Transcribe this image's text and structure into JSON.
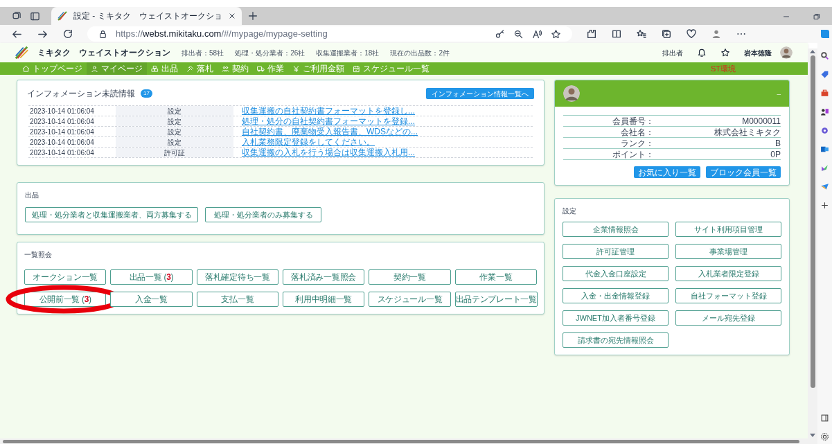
{
  "browser": {
    "tab_title": "設定 - ミキタク　ウェイストオークショ",
    "url_host": "webst.mikitaku.com",
    "url_scheme": "https://",
    "url_path": "/#/mypage/mypage-setting"
  },
  "site": {
    "brand": "ミキタク　ウェイストオークション",
    "stats": [
      "排出者：58社",
      "処理・処分業者：26社",
      "収集運搬業者：18社",
      "現在の出品数：2件"
    ],
    "user_role": "排出者",
    "user_name": "岩本徳隆"
  },
  "nav": {
    "items": [
      {
        "label": "トップページ",
        "kind": "home",
        "selected": false
      },
      {
        "label": "マイページ",
        "kind": "user",
        "selected": true
      },
      {
        "label": "出品",
        "kind": "boxes",
        "selected": false
      },
      {
        "label": "落札",
        "kind": "gavel",
        "selected": false
      },
      {
        "label": "契約",
        "kind": "people",
        "selected": false
      },
      {
        "label": "作業",
        "kind": "truck",
        "selected": false
      },
      {
        "label": "ご利用金額",
        "kind": "yen",
        "selected": false
      },
      {
        "label": "スケジュール一覧",
        "kind": "calendar",
        "selected": false
      }
    ],
    "env": "ST環境"
  },
  "info": {
    "title": "インフォメーション未読情報",
    "count": "17",
    "button": "インフォメーション情報一覧へ",
    "rows": [
      {
        "date": "2023-10-14 01:06:04",
        "category": "設定",
        "link": "収集運搬の自社契約書フォーマットを登録し..."
      },
      {
        "date": "2023-10-14 01:06:04",
        "category": "設定",
        "link": "処理・処分の自社契約書フォーマットを登録..."
      },
      {
        "date": "2023-10-14 01:06:04",
        "category": "設定",
        "link": "自社契約書、廃棄物受入報告書、WDSなどの..."
      },
      {
        "date": "2023-10-14 01:06:04",
        "category": "設定",
        "link": "入札業務限定登録をしてください。"
      },
      {
        "date": "2023-10-14 01:06:04",
        "category": "許可証",
        "link": "収集運搬の入札を行う場合は収集運搬入札用..."
      }
    ]
  },
  "listing": {
    "title": "出品",
    "buttons": [
      "処理・処分業者と収集運搬業者、両方募集する",
      "処理・処分業者のみ募集する"
    ]
  },
  "lists": {
    "title": "一覧照会",
    "buttons": [
      {
        "label": "オークション一覧",
        "circled": false
      },
      {
        "label": "出品一覧 (**3**)",
        "circled": false
      },
      {
        "label": "落札確定待ち一覧",
        "circled": false
      },
      {
        "label": "落札済み一覧照会",
        "circled": false
      },
      {
        "label": "契約一覧",
        "circled": false
      },
      {
        "label": "作業一覧",
        "circled": false
      },
      {
        "label": "公開前一覧 (**3**)",
        "circled": true
      },
      {
        "label": "入金一覧",
        "circled": false
      },
      {
        "label": "支払一覧",
        "circled": false
      },
      {
        "label": "利用中明細一覧",
        "circled": false
      },
      {
        "label": "スケジュール一覧",
        "circled": false
      },
      {
        "label": "出品テンプレート一覧",
        "circled": false
      }
    ]
  },
  "profile": {
    "collapse": "–",
    "fields": [
      {
        "label": "会員番号：",
        "value": "M0000011"
      },
      {
        "label": "会社名：",
        "value": "株式会社ミキタク"
      },
      {
        "label": "ランク：",
        "value": "B"
      },
      {
        "label": "ポイント：",
        "value": "0P"
      }
    ],
    "buttons": [
      "お気に入り一覧",
      "ブロック会員一覧"
    ]
  },
  "settings": {
    "title": "設定",
    "buttons": [
      "企業情報照会",
      "サイト利用項目管理",
      "許可証管理",
      "事業場管理",
      "代金入金口座設定",
      "入札業者限定登録",
      "入金・出金情報登録",
      "自社フォーマット登録",
      "JWNET加入者番号登録",
      "メール宛先登録",
      "請求書の宛先情報照会"
    ]
  }
}
